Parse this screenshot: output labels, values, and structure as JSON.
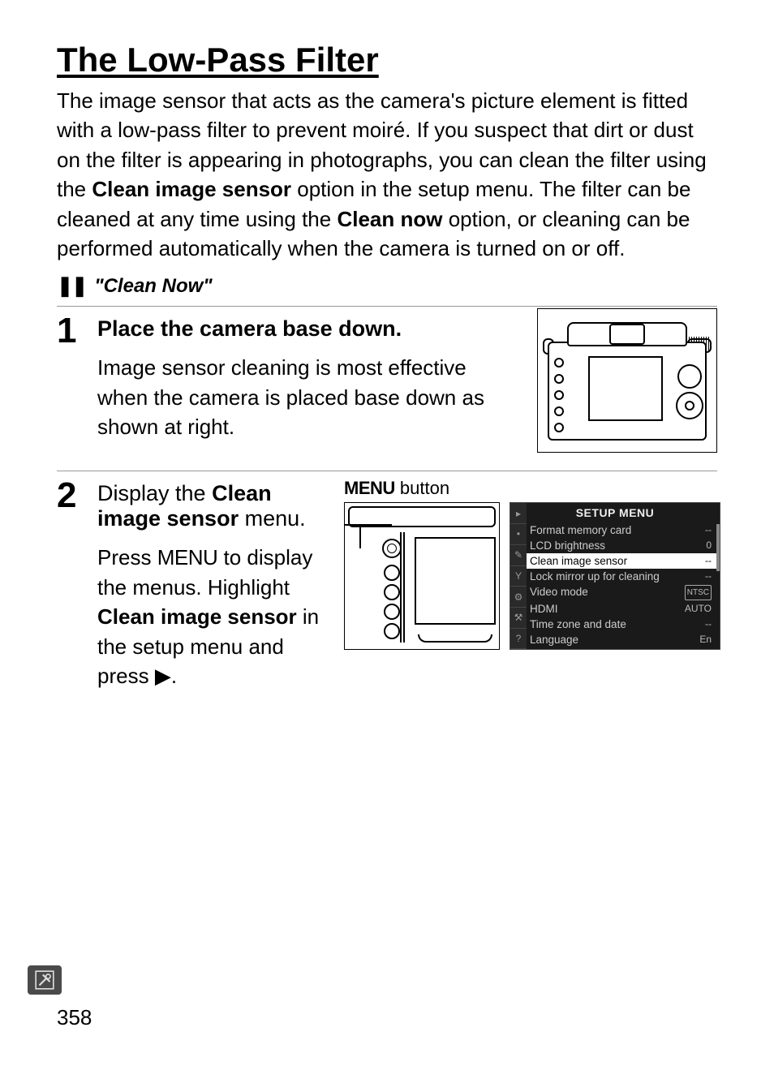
{
  "title": "The Low-Pass Filter",
  "intro_parts": {
    "p1": "The image sensor that acts as the camera's picture element is fitted with a low-pass filter to prevent moiré.  If you suspect that dirt or dust on the filter is appearing in photographs, you can clean the filter using the ",
    "b1": "Clean image sensor",
    "p2": " option in the setup menu.  The filter can be cleaned at any time using the ",
    "b2": "Clean now",
    "p3": " option, or cleaning can be performed automatically when the camera is turned on or off."
  },
  "subsection": "\"Clean Now\"",
  "step1": {
    "num": "1",
    "title": "Place the camera base down.",
    "body": "Image sensor cleaning is most effective when the camera is placed base down as shown at right."
  },
  "step2": {
    "num": "2",
    "title_a": "Display the ",
    "title_b": "Clean image sensor",
    "title_c": " menu.",
    "body_a": "Press ",
    "body_menu": "MENU",
    "body_b": " to display the menus.  Highlight ",
    "body_bold": "Clean image sensor",
    "body_c": " in the setup menu and press ",
    "body_d": ".",
    "caption_a": "MENU",
    "caption_b": " button"
  },
  "setup_menu": {
    "header": "SETUP MENU",
    "tabs": [
      "▸",
      "•",
      "✎",
      "Y",
      "⚙",
      "⚒",
      "?"
    ],
    "rows": [
      {
        "label": "Format memory card",
        "value": "--"
      },
      {
        "label": "LCD brightness",
        "value": "0"
      },
      {
        "label": "Clean image sensor",
        "value": "--",
        "hl": true
      },
      {
        "label": "Lock mirror up for cleaning",
        "value": "--"
      },
      {
        "label": "Video mode",
        "value": "NTSC",
        "boxed": true
      },
      {
        "label": "HDMI",
        "value": "AUTO"
      },
      {
        "label": "Time zone and date",
        "value": "--"
      },
      {
        "label": "Language",
        "value": "En"
      }
    ]
  },
  "page_number": "358"
}
